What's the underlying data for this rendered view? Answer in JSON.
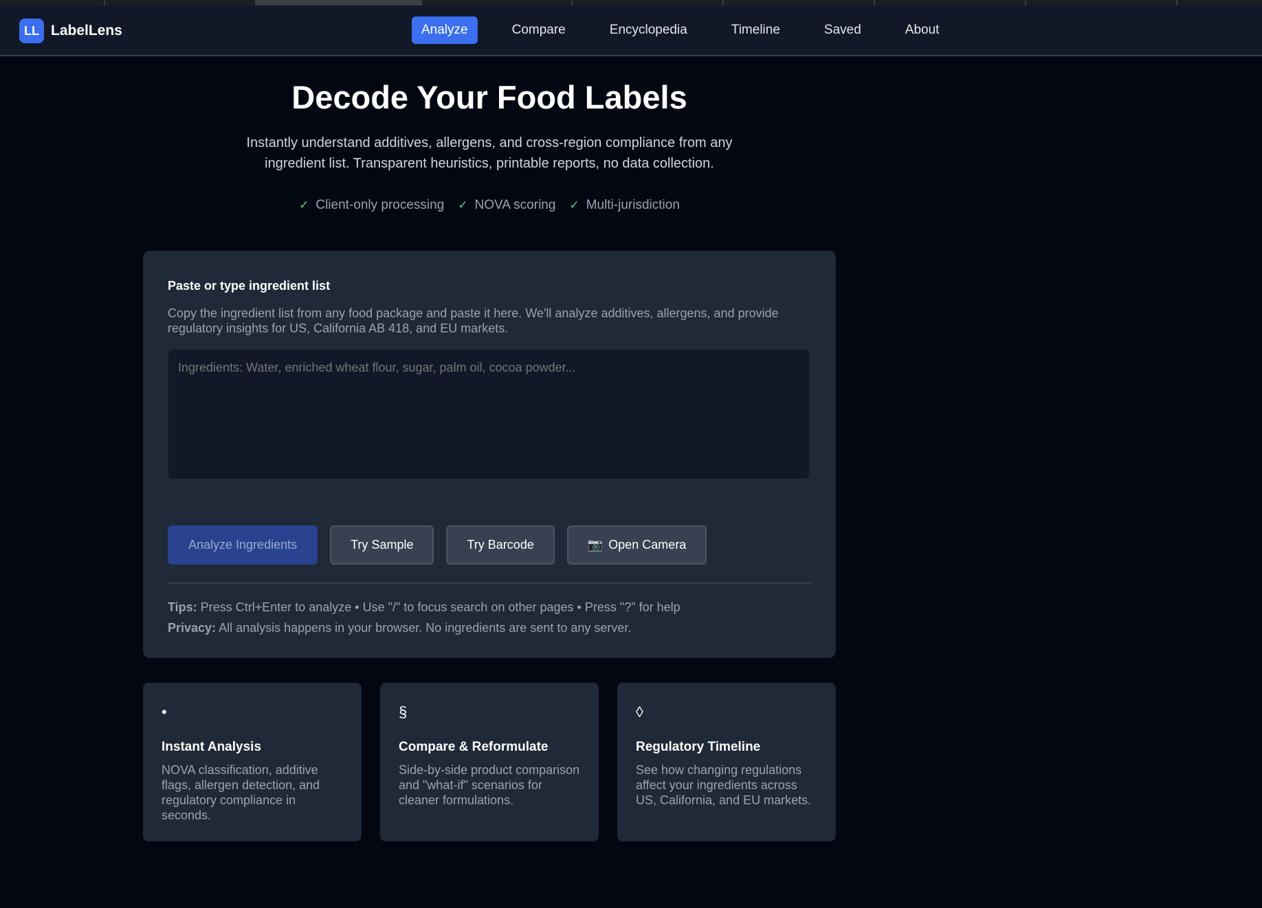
{
  "brand": {
    "logo_text": "LL",
    "name": "LabelLens"
  },
  "nav": {
    "items": [
      {
        "label": "Analyze",
        "active": true
      },
      {
        "label": "Compare"
      },
      {
        "label": "Encyclopedia"
      },
      {
        "label": "Timeline"
      },
      {
        "label": "Saved"
      },
      {
        "label": "About"
      }
    ]
  },
  "hero": {
    "title": "Decode Your Food Labels",
    "subtitle": "Instantly understand additives, allergens, and cross-region compliance from any ingredient list. Transparent heuristics, printable reports, no data collection.",
    "checks": [
      "Client-only processing",
      "NOVA scoring",
      "Multi-jurisdiction"
    ]
  },
  "input_card": {
    "label": "Paste or type ingredient list",
    "help": "Copy the ingredient list from any food package and paste it here. We'll analyze additives, allergens, and provide regulatory insights for US, California AB 418, and EU markets.",
    "placeholder": "Ingredients: Water, enriched wheat flour, sugar, palm oil, cocoa powder...",
    "value": "",
    "buttons": {
      "analyze": "Analyze Ingredients",
      "sample": "Try Sample",
      "barcode": "Try Barcode",
      "camera": "Open Camera"
    },
    "tips_label": "Tips:",
    "tips_text": "Press Ctrl+Enter to analyze • Use \"/\" to focus search on other pages • Press \"?\" for help",
    "privacy_label": "Privacy:",
    "privacy_text": "All analysis happens in your browser. No ingredients are sent to any server."
  },
  "features": [
    {
      "icon": "•",
      "title": "Instant Analysis",
      "desc": "NOVA classification, additive flags, allergen detection, and regulatory compliance in seconds."
    },
    {
      "icon": "§",
      "title": "Compare & Reformulate",
      "desc": "Side-by-side product comparison and \"what-if\" scenarios for cleaner formulations."
    },
    {
      "icon": "◊",
      "title": "Regulatory Timeline",
      "desc": "See how changing regulations affect your ingredients across US, California, and EU markets."
    }
  ],
  "colors": {
    "accent": "#3b6ff0",
    "background": "#030712",
    "card": "#1f2937",
    "check": "#4ade80"
  }
}
